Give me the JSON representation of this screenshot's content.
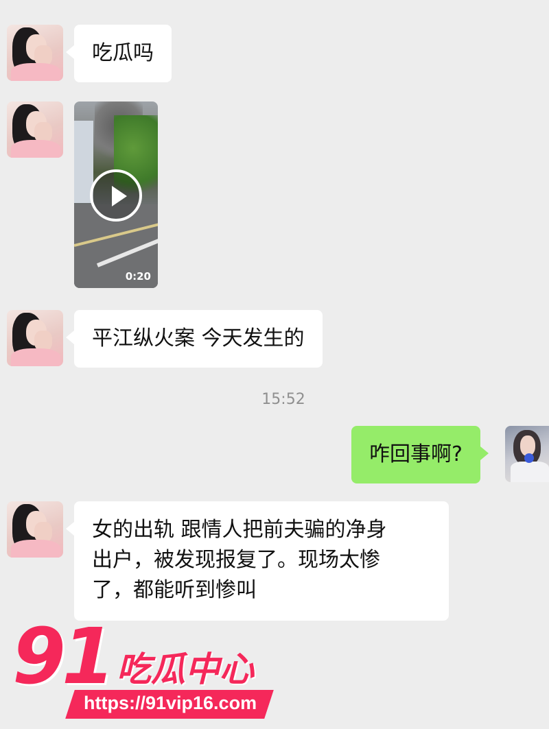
{
  "chat": {
    "messages": [
      {
        "side": "left",
        "text": "吃瓜吗"
      },
      {
        "side": "left",
        "type": "video",
        "duration": "0:20"
      },
      {
        "side": "left",
        "text": "平江纵火案 今天发生的"
      },
      {
        "type": "timestamp",
        "text": "15:52"
      },
      {
        "side": "right",
        "text": "咋回事啊?"
      },
      {
        "side": "left",
        "lines": [
          "女的出轨 跟情人把前夫骗的净身",
          "出户，被发现报复了。现场太惨",
          "了，都能听到惨叫"
        ]
      }
    ]
  },
  "watermark": {
    "number": "91",
    "brand": "吃瓜中心",
    "url": "https://91vip16.com"
  },
  "colors": {
    "background": "#ededed",
    "bubble_incoming": "#ffffff",
    "bubble_outgoing": "#95ec69",
    "timestamp": "#8f8f8f",
    "watermark": "#f5285a"
  },
  "icons": {
    "video_play": "play-icon"
  }
}
